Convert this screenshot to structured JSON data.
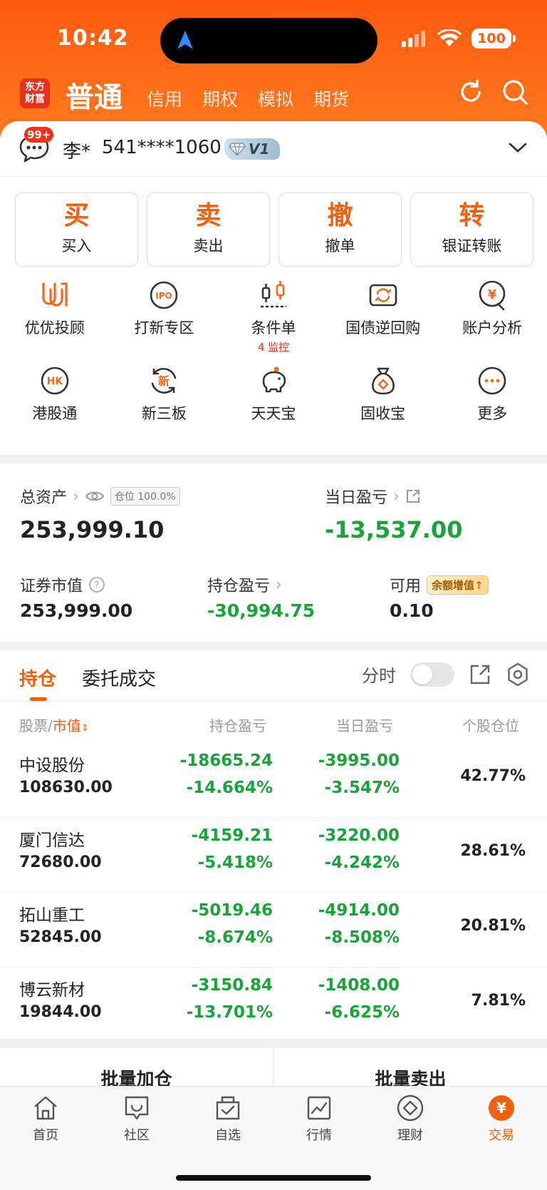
{
  "status": {
    "time": "10:42",
    "battery": "100"
  },
  "header": {
    "logo_line1": "东方",
    "logo_line2": "财富",
    "active_tab": "普通",
    "tabs": [
      "信用",
      "期权",
      "模拟",
      "期货"
    ]
  },
  "account": {
    "badge": "99+",
    "name": "李*",
    "number": "541****1060",
    "vip_level": "V1"
  },
  "quick_actions": [
    {
      "big": "买",
      "label": "买入"
    },
    {
      "big": "卖",
      "label": "卖出"
    },
    {
      "big": "撤",
      "label": "撤单"
    },
    {
      "big": "转",
      "label": "银证转账"
    }
  ],
  "functions_row1": [
    {
      "label": "优优投顾",
      "icon": "uu-advisor-icon"
    },
    {
      "label": "打新专区",
      "icon": "ipo-icon"
    },
    {
      "label": "条件单",
      "sub": "4 监控",
      "icon": "condition-order-icon"
    },
    {
      "label": "国债逆回购",
      "icon": "reverse-repo-icon"
    },
    {
      "label": "账户分析",
      "icon": "account-analysis-icon"
    }
  ],
  "functions_row2": [
    {
      "label": "港股通",
      "icon": "hk-icon"
    },
    {
      "label": "新三板",
      "icon": "new-third-board-icon"
    },
    {
      "label": "天天宝",
      "icon": "piggy-bank-icon"
    },
    {
      "label": "固收宝",
      "icon": "money-bag-icon"
    },
    {
      "label": "更多",
      "icon": "more-icon"
    }
  ],
  "assets": {
    "total_label": "总资产",
    "position_tag": "仓位 100.0%",
    "total_value": "253,999.10",
    "daily_pl_label": "当日盈亏",
    "daily_pl_value": "-13,537.00",
    "securities_label": "证券市值",
    "securities_value": "253,999.00",
    "holding_pl_label": "持仓盈亏",
    "holding_pl_value": "-30,994.75",
    "available_label": "可用",
    "available_tag": "余额增值",
    "available_value": "0.10"
  },
  "holdings": {
    "tab_active": "持仓",
    "tab_other": "委托成交",
    "timeshare_label": "分时",
    "col_stock": "股票/",
    "col_mv": "市值",
    "col_holding_pl": "持仓盈亏",
    "col_daily_pl": "当日盈亏",
    "col_position": "个股仓位",
    "rows": [
      {
        "name": "中设股份",
        "mv": "108630.00",
        "hpl": "-18665.24",
        "hpct": "-14.664%",
        "dpl": "-3995.00",
        "dpct": "-3.547%",
        "pos": "42.77%"
      },
      {
        "name": "厦门信达",
        "mv": "72680.00",
        "hpl": "-4159.21",
        "hpct": "-5.418%",
        "dpl": "-3220.00",
        "dpct": "-4.242%",
        "pos": "28.61%"
      },
      {
        "name": "拓山重工",
        "mv": "52845.00",
        "hpl": "-5019.46",
        "hpct": "-8.674%",
        "dpl": "-4914.00",
        "dpct": "-8.508%",
        "pos": "20.81%"
      },
      {
        "name": "博云新材",
        "mv": "19844.00",
        "hpl": "-3150.84",
        "hpct": "-13.701%",
        "dpl": "-1408.00",
        "dpct": "-6.625%",
        "pos": "7.81%"
      }
    ]
  },
  "batch": {
    "add": "批量加仓",
    "sell": "批量卖出"
  },
  "bottom_nav": [
    "首页",
    "社区",
    "自选",
    "行情",
    "理财",
    "交易"
  ],
  "colors": {
    "brand": "#f0600f",
    "loss_green": "#1aa33a",
    "badge_red": "#f2301e"
  }
}
